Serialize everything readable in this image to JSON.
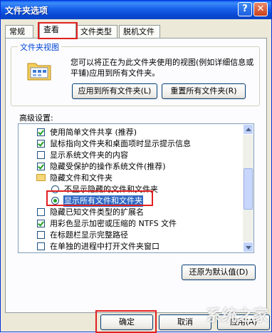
{
  "window": {
    "title": "文件夹选项",
    "help_glyph": "?",
    "close_glyph": "✕"
  },
  "tabs": [
    {
      "label": "常规",
      "active": false
    },
    {
      "label": "查看",
      "active": true
    },
    {
      "label": "文件类型",
      "active": false
    },
    {
      "label": "脱机文件",
      "active": false
    }
  ],
  "folder_view": {
    "title": "文件夹视图",
    "description": "您可以将正在为此文件夹使用的视图(例如详细信息或平铺)应用到所有文件夹。",
    "apply_all_label": "应用到所有文件夹(L)",
    "reset_all_label": "重置所有文件夹(R)"
  },
  "advanced": {
    "label": "高级设置:",
    "items": [
      {
        "kind": "checkbox",
        "checked": true,
        "label": "使用简单文件共享 (推荐)"
      },
      {
        "kind": "checkbox",
        "checked": true,
        "label": "鼠标指向文件夹和桌面项时显示提示信息"
      },
      {
        "kind": "checkbox",
        "checked": false,
        "label": "显示系统文件夹的内容"
      },
      {
        "kind": "checkbox",
        "checked": true,
        "label": "隐藏受保护的操作系统文件(推荐)"
      },
      {
        "kind": "folder",
        "label": "隐藏文件和文件夹"
      },
      {
        "kind": "radio",
        "checked": false,
        "label": "不显示隐藏的文件和文件夹"
      },
      {
        "kind": "radio",
        "checked": true,
        "label": "显示所有文件和文件夹",
        "selected": true
      },
      {
        "kind": "checkbox",
        "checked": false,
        "label": "隐藏已知文件类型的扩展名"
      },
      {
        "kind": "checkbox",
        "checked": true,
        "label": "用彩色显示加密或压缩的 NTFS 文件"
      },
      {
        "kind": "checkbox",
        "checked": false,
        "label": "在标题栏显示完整路径"
      },
      {
        "kind": "checkbox",
        "checked": false,
        "label": "在单独的进程中打开文件夹窗口"
      }
    ],
    "restore_defaults_label": "还原为默认值(D)"
  },
  "footer": {
    "ok_label": "确定",
    "cancel_label": "取消",
    "apply_label": "应用(A)"
  },
  "watermark": "系统之家",
  "colors": {
    "title_bar": "#0a5ef0",
    "highlight": "#e02020",
    "check": "#21a121",
    "selection": "#316ac5"
  }
}
